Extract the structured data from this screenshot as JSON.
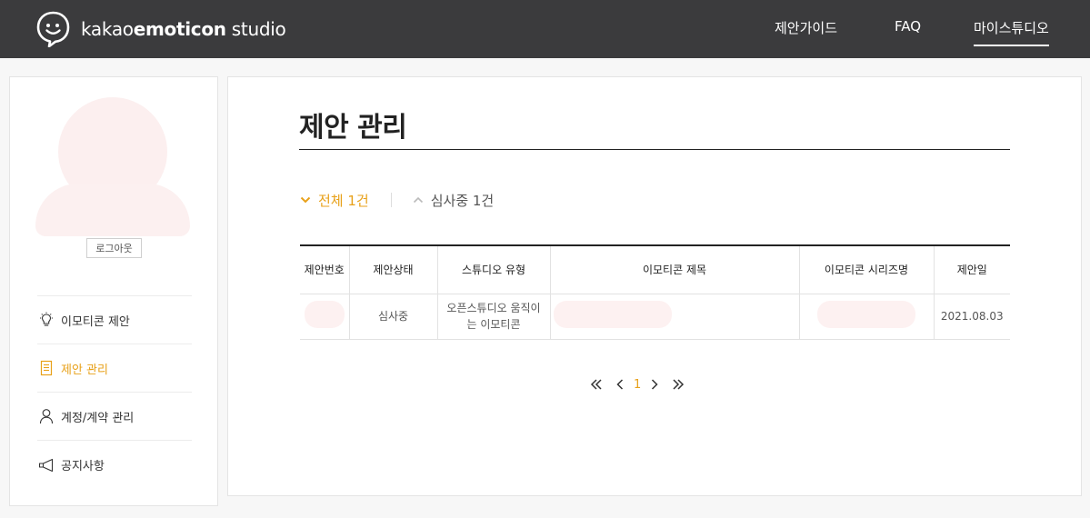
{
  "header": {
    "logo": {
      "light": "kakao",
      "bold": "emoticon",
      "suffix": " studio"
    },
    "nav": [
      {
        "label": "제안가이드"
      },
      {
        "label": "FAQ"
      },
      {
        "label": "마이스튜디오"
      }
    ]
  },
  "sidebar": {
    "logout_label": "로그아웃",
    "menu": [
      {
        "label": "이모티콘 제안",
        "icon": "lightbulb-icon",
        "active": false
      },
      {
        "label": "제안 관리",
        "icon": "document-icon",
        "active": true
      },
      {
        "label": "계정/계약 관리",
        "icon": "person-icon",
        "active": false
      },
      {
        "label": "공지사항",
        "icon": "megaphone-icon",
        "active": false
      }
    ]
  },
  "main": {
    "title": "제안 관리",
    "filters": [
      {
        "label": "전체 1건",
        "active": true
      },
      {
        "label": "심사중 1건",
        "active": false
      }
    ],
    "table": {
      "headers": [
        "제안번호",
        "제안상태",
        "스튜디오 유형",
        "이모티콘 제목",
        "이모티콘 시리즈명",
        "제안일"
      ],
      "rows": [
        {
          "number": "",
          "status": "심사중",
          "type_line1": "오픈스튜디오 움직이",
          "type_line2": "는 이모티콘",
          "title": "",
          "series": "",
          "date": "2021.08.03"
        }
      ]
    },
    "pagination": {
      "current": "1"
    }
  },
  "colors": {
    "header_bg": "#3b3b3d",
    "accent": "#e8a11a"
  }
}
